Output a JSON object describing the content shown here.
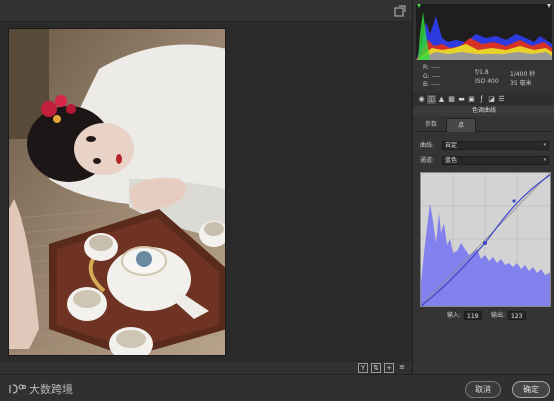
{
  "preview": {
    "photo_alt": ""
  },
  "info": {
    "r": "R:",
    "g": "G:",
    "b": "B:",
    "dash": "----",
    "aperture": "f/1.8",
    "shutter": "1/400 秒",
    "iso": "ISO 400",
    "focal": "35 毫米"
  },
  "panel": {
    "title": "色调曲线",
    "tab_param": "参数",
    "tab_point": "点"
  },
  "curve_field": {
    "label": "曲线:",
    "value": "自定"
  },
  "channel_field": {
    "label": "通道:",
    "value": "蓝色"
  },
  "io": {
    "input_label": "输入:",
    "input_value": "119",
    "output_label": "输出:",
    "output_value": "123"
  },
  "footer": {
    "brand": "大数跨境",
    "cancel": "取消",
    "ok": "确定"
  },
  "colors": {
    "accent_blue": "#7472f2",
    "curve_line": "#3b46c9"
  },
  "icons": [
    "histogram-toggle-icon",
    "basic-icon",
    "tone-curve-icon",
    "detail-icon",
    "hsl-icon",
    "split-toning-icon",
    "lens-icon",
    "fx-icon",
    "camera-calibration-icon",
    "presets-icon"
  ],
  "preview_tools": [
    "Y",
    "compare",
    "plus",
    "menu"
  ]
}
